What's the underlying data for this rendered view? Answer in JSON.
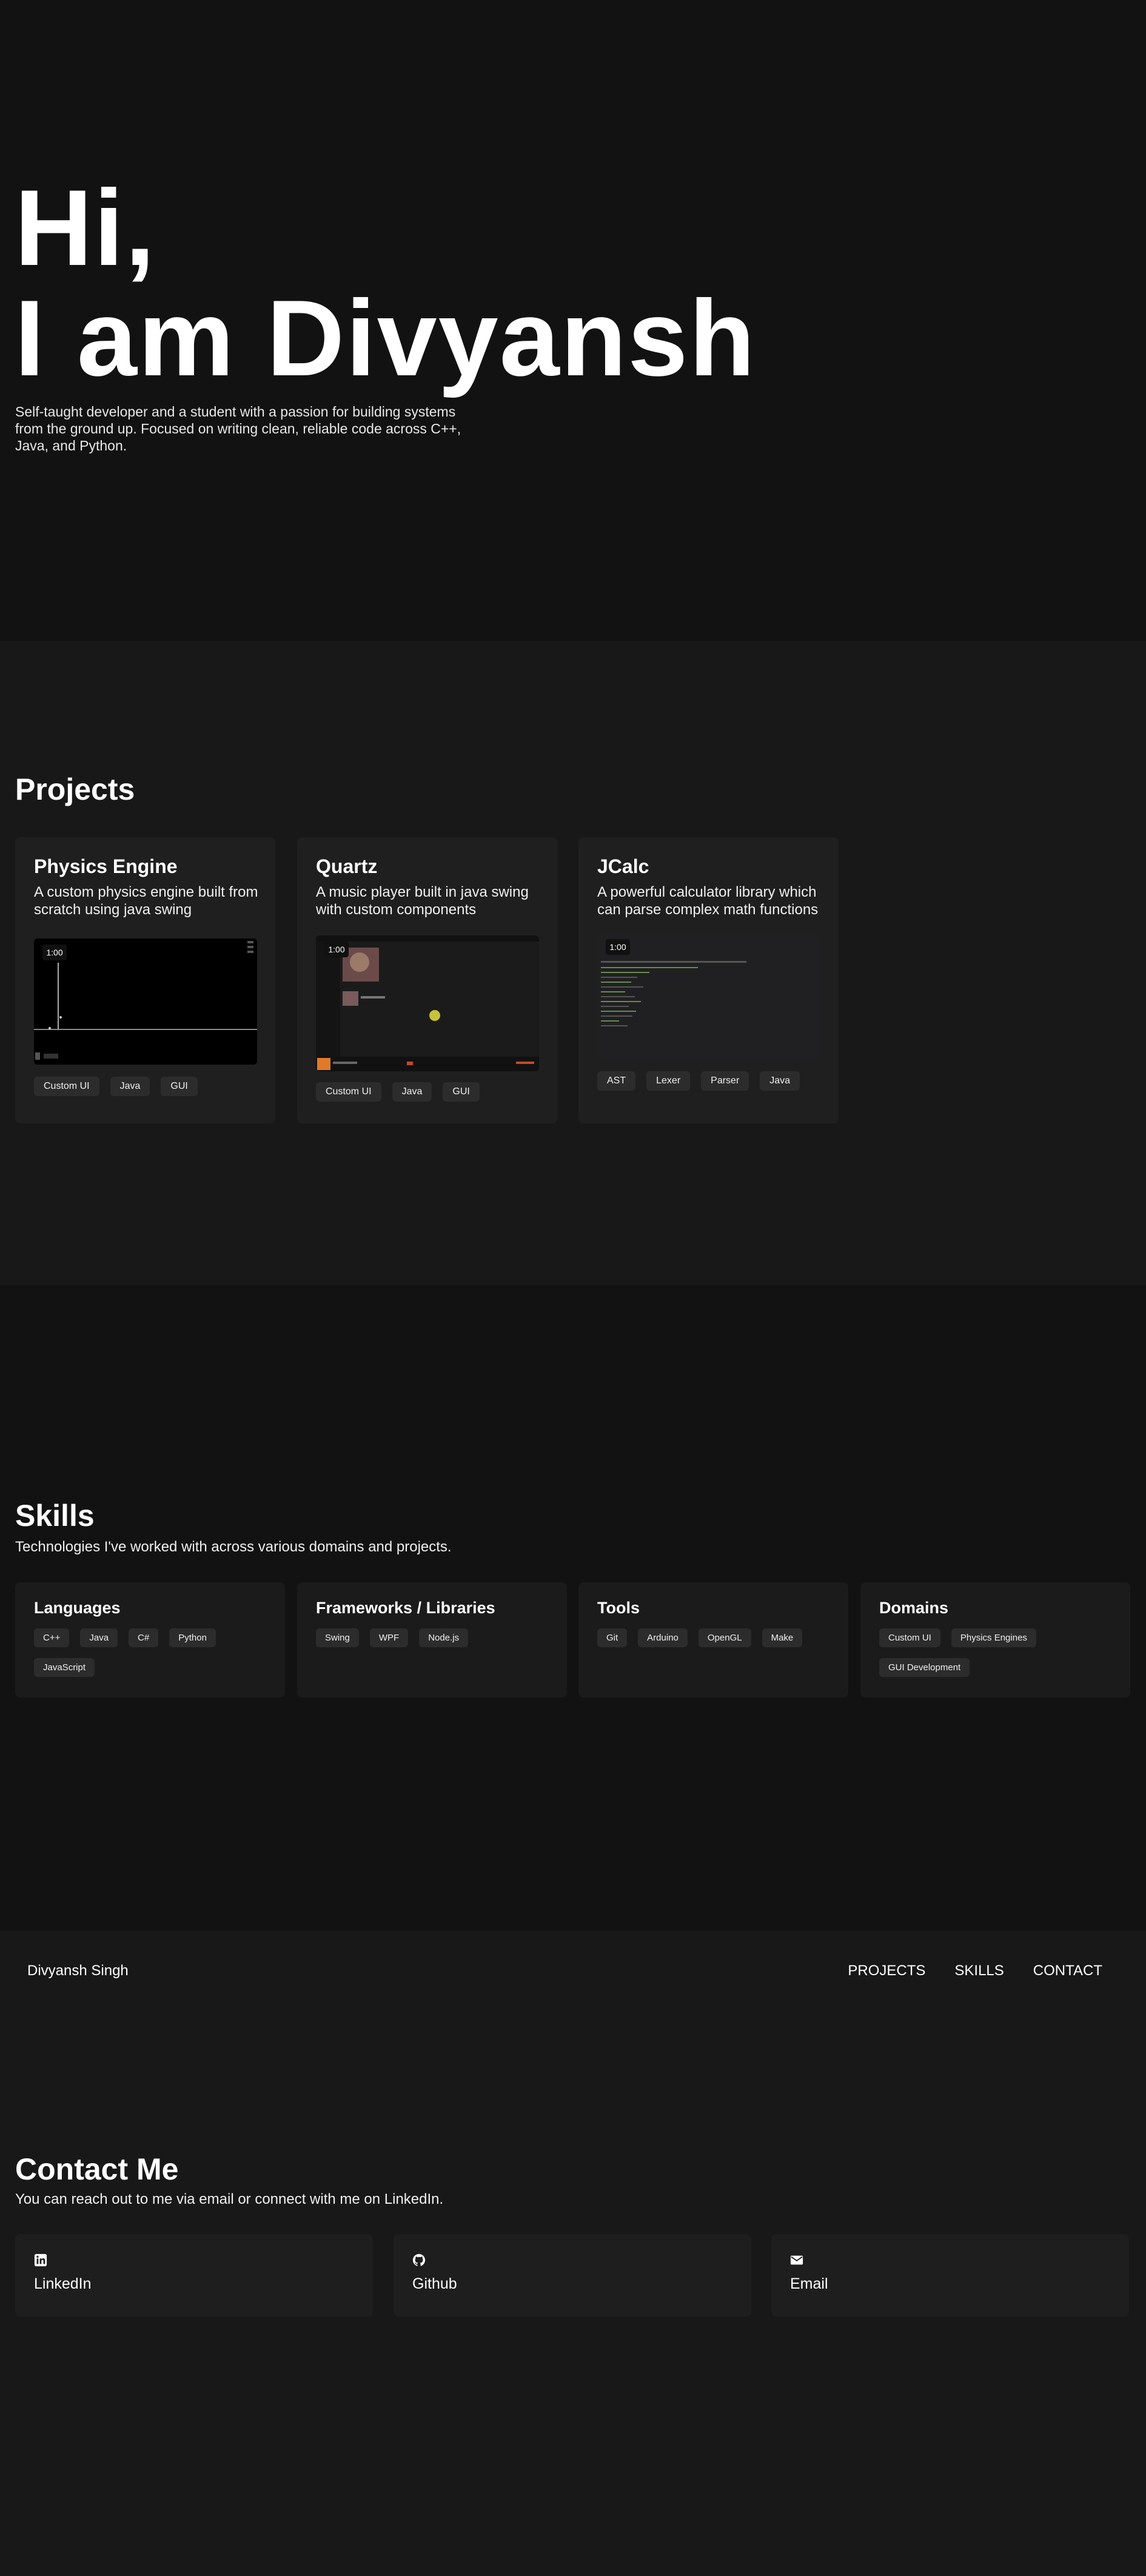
{
  "hero": {
    "line1": "Hi,",
    "line2": "I am Divyansh",
    "description": "Self-taught developer and a student with a passion for building systems from the ground up. Focused on writing clean, reliable code across C++, Java, and Python."
  },
  "projects": {
    "title": "Projects",
    "items": [
      {
        "title": "Physics Engine",
        "description": "A custom physics engine built from scratch using java swing",
        "time": "1:00",
        "tags": [
          "Custom UI",
          "Java",
          "GUI"
        ]
      },
      {
        "title": "Quartz",
        "description": "A music player built in java swing with custom components",
        "time": "1:00",
        "tags": [
          "Custom UI",
          "Java",
          "GUI"
        ]
      },
      {
        "title": "JCalc",
        "description": "A powerful calculator library which can parse complex math functions",
        "time": "1:00",
        "tags": [
          "AST",
          "Lexer",
          "Parser",
          "Java"
        ]
      }
    ]
  },
  "skills": {
    "title": "Skills",
    "subtitle": "Technologies I've worked with across various domains and projects.",
    "groups": [
      {
        "title": "Languages",
        "tags": [
          "C++",
          "Java",
          "C#",
          "Python",
          "JavaScript"
        ]
      },
      {
        "title": "Frameworks / Libraries",
        "tags": [
          "Swing",
          "WPF",
          "Node.js"
        ]
      },
      {
        "title": "Tools",
        "tags": [
          "Git",
          "Arduino",
          "OpenGL",
          "Make"
        ]
      },
      {
        "title": "Domains",
        "tags": [
          "Custom UI",
          "Physics Engines",
          "GUI Development"
        ]
      }
    ]
  },
  "nav": {
    "name": "Divyansh Singh",
    "links": [
      "PROJECTS",
      "SKILLS",
      "CONTACT"
    ]
  },
  "contact": {
    "title": "Contact Me",
    "subtitle": "You can reach out to me via email or connect with me on LinkedIn.",
    "cards": [
      {
        "label": "LinkedIn",
        "icon": "linkedin-icon"
      },
      {
        "label": "Github",
        "icon": "github-icon"
      },
      {
        "label": "Email",
        "icon": "envelope-icon"
      }
    ]
  }
}
